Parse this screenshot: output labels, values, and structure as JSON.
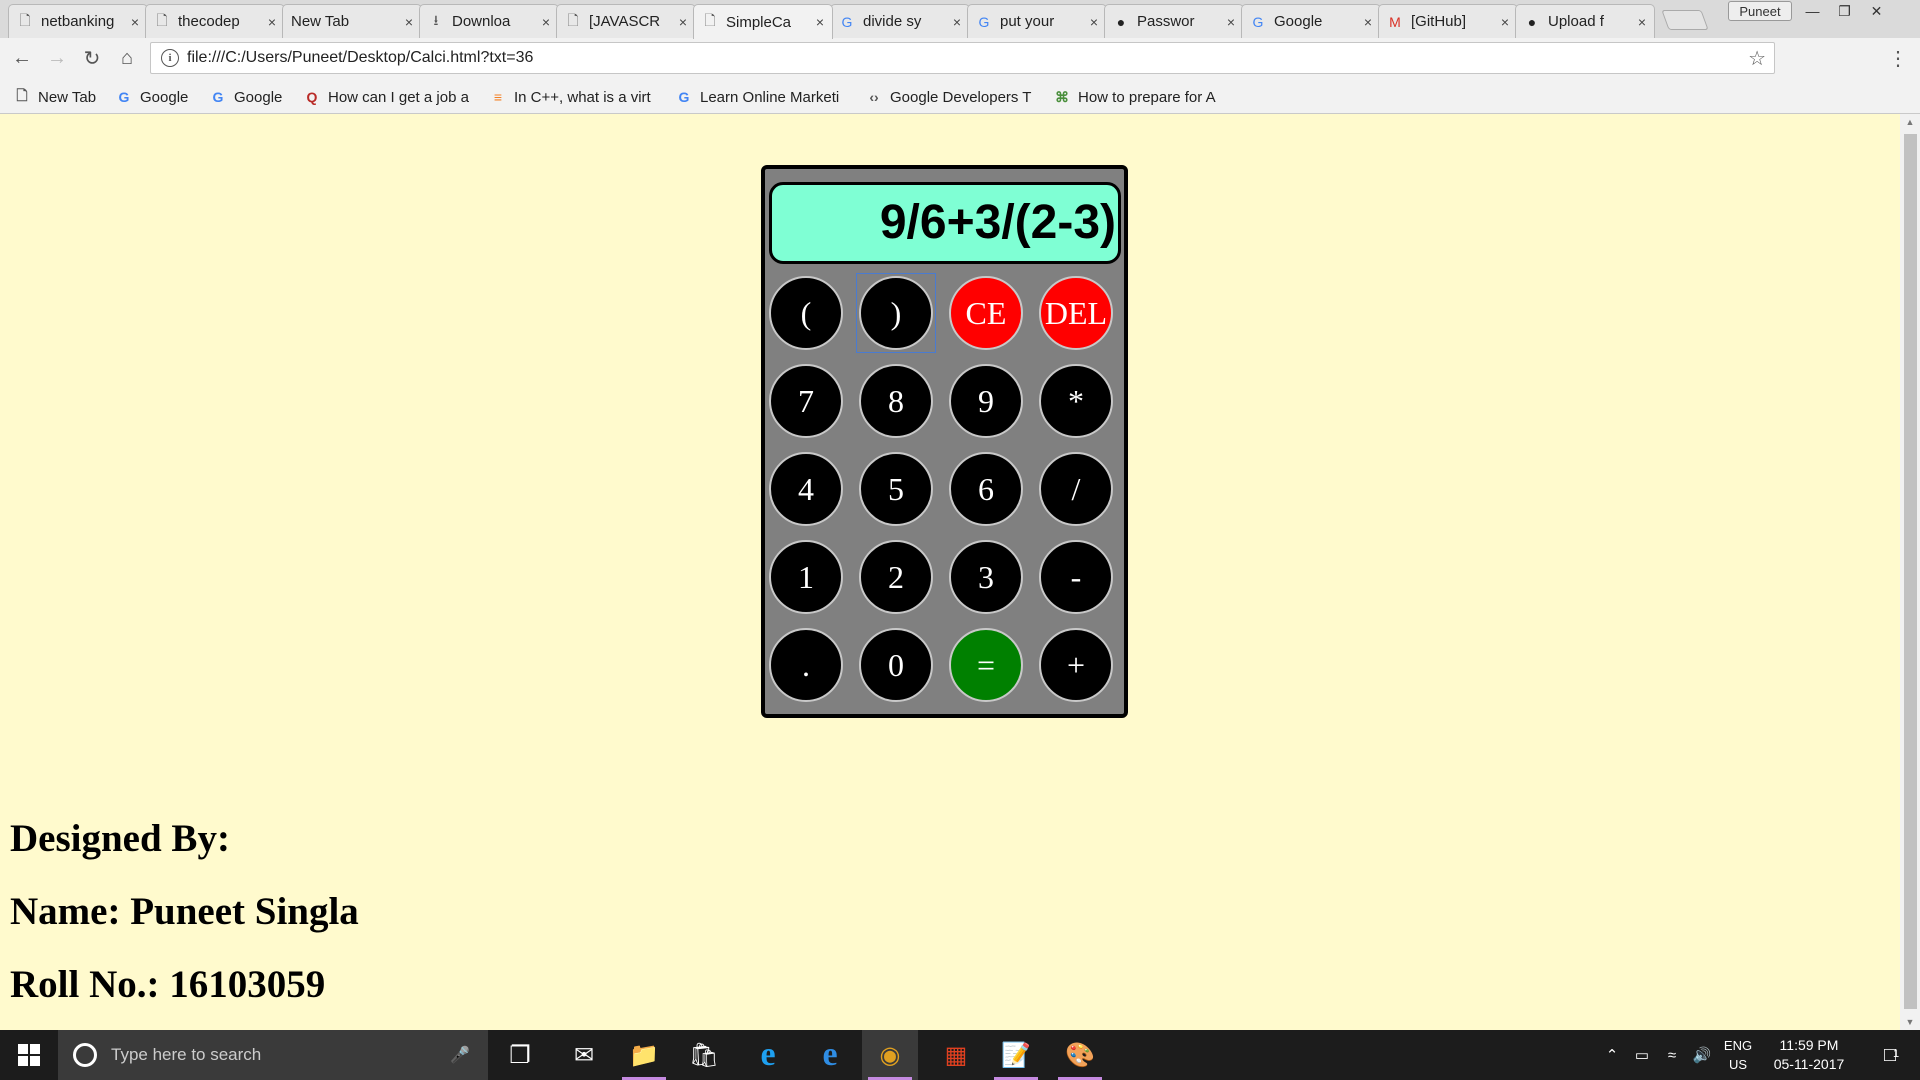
{
  "browser": {
    "tabs": [
      {
        "title": "netbanking",
        "icon": "page-icon"
      },
      {
        "title": "thecodep",
        "icon": "page-icon"
      },
      {
        "title": "New Tab",
        "icon": "none"
      },
      {
        "title": "Downloa",
        "icon": "download-icon"
      },
      {
        "title": "[JAVASCR",
        "icon": "page-icon"
      },
      {
        "title": "SimpleCa",
        "icon": "page-icon"
      },
      {
        "title": "divide sy",
        "icon": "google-icon"
      },
      {
        "title": "put your",
        "icon": "google-icon"
      },
      {
        "title": "Passwor",
        "icon": "github-icon"
      },
      {
        "title": "Google",
        "icon": "google-icon"
      },
      {
        "title": "[GitHub]",
        "icon": "gmail-icon"
      },
      {
        "title": "Upload f",
        "icon": "github-icon"
      }
    ],
    "active_tab_index": 5,
    "tab_close_glyph": "×",
    "profile_name": "Puneet",
    "url": "file:///C:/Users/Puneet/Desktop/Calci.html?txt=36",
    "bookmarks": [
      {
        "label": "New Tab",
        "icon": "page-icon"
      },
      {
        "label": "Google",
        "icon": "google-icon"
      },
      {
        "label": "Google",
        "icon": "google-icon"
      },
      {
        "label": "How can I get a job a",
        "icon": "quora-icon"
      },
      {
        "label": "In C++, what is a virt",
        "icon": "stackoverflow-icon"
      },
      {
        "label": "Learn Online Marketi",
        "icon": "google-icon"
      },
      {
        "label": "Google Developers T",
        "icon": "google-developers-icon"
      },
      {
        "label": "How to prepare for A",
        "icon": "hackerearth-icon"
      }
    ]
  },
  "calculator": {
    "display": "9/6+3/(2-3)",
    "keys": [
      {
        "label": "(",
        "style": "normal"
      },
      {
        "label": ")",
        "style": "normal",
        "focused": true
      },
      {
        "label": "CE",
        "style": "red"
      },
      {
        "label": "DEL",
        "style": "red"
      },
      {
        "label": "7",
        "style": "normal"
      },
      {
        "label": "8",
        "style": "normal"
      },
      {
        "label": "9",
        "style": "normal"
      },
      {
        "label": "*",
        "style": "normal"
      },
      {
        "label": "4",
        "style": "normal"
      },
      {
        "label": "5",
        "style": "normal"
      },
      {
        "label": "6",
        "style": "normal"
      },
      {
        "label": "/",
        "style": "normal"
      },
      {
        "label": "1",
        "style": "normal"
      },
      {
        "label": "2",
        "style": "normal"
      },
      {
        "label": "3",
        "style": "normal"
      },
      {
        "label": "-",
        "style": "normal"
      },
      {
        "label": ".",
        "style": "normal"
      },
      {
        "label": "0",
        "style": "normal"
      },
      {
        "label": "=",
        "style": "green"
      },
      {
        "label": "+",
        "style": "normal"
      }
    ]
  },
  "credits": {
    "heading": "Designed By:",
    "name": "Name: Puneet Singla",
    "roll": "Roll No.: 16103059"
  },
  "taskbar": {
    "search_placeholder": "Type here to search",
    "apps": [
      "task-view-icon",
      "mail-icon",
      "file-explorer-icon",
      "store-icon",
      "internet-explorer-icon",
      "edge-icon",
      "chrome-icon",
      "office-icon",
      "notepad-icon",
      "paint-icon"
    ],
    "language_line1": "ENG",
    "language_line2": "US",
    "time": "11:59 PM",
    "date": "05-11-2017",
    "notification_count": "1"
  },
  "colors": {
    "page_background": "#fffacd",
    "display_background": "#7fffd4",
    "calculator_body": "#808080",
    "key_normal": "#000000",
    "key_red": "#ff0000",
    "key_green": "#008000"
  }
}
